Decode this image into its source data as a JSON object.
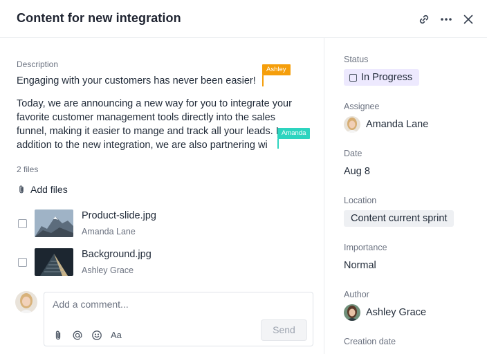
{
  "header": {
    "title": "Content for new integration",
    "icons": [
      "link-icon",
      "more-icon",
      "close-icon"
    ]
  },
  "description": {
    "label": "Description",
    "paragraph1": "Engaging with your customers has never been easier!",
    "paragraph2_lines": [
      "Today, we are announcing a new way for you to integrate your",
      "favorite customer management tools directly into the sales",
      "funnel, making it easier to mange and track all your leads. In",
      "addition to the new integration, we are also partnering wi"
    ],
    "cursors": [
      {
        "name": "Ashley",
        "color": "#f59e0b"
      },
      {
        "name": "Amanda",
        "color": "#2dd4bf"
      }
    ]
  },
  "files": {
    "count_label": "2 files",
    "add_label": "Add files",
    "items": [
      {
        "name": "Product-slide.jpg",
        "author": "Amanda Lane"
      },
      {
        "name": "Background.jpg",
        "author": "Ashley Grace"
      }
    ]
  },
  "comment": {
    "placeholder": "Add a comment...",
    "send_label": "Send",
    "format_label": "Aa"
  },
  "sidebar": {
    "status_label": "Status",
    "status_value": "In Progress",
    "assignee_label": "Assignee",
    "assignee_value": "Amanda Lane",
    "date_label": "Date",
    "date_value": "Aug 8",
    "location_label": "Location",
    "location_value": "Content current sprint",
    "importance_label": "Importance",
    "importance_value": "Normal",
    "author_label": "Author",
    "author_value": "Ashley Grace",
    "creation_label": "Creation date"
  }
}
